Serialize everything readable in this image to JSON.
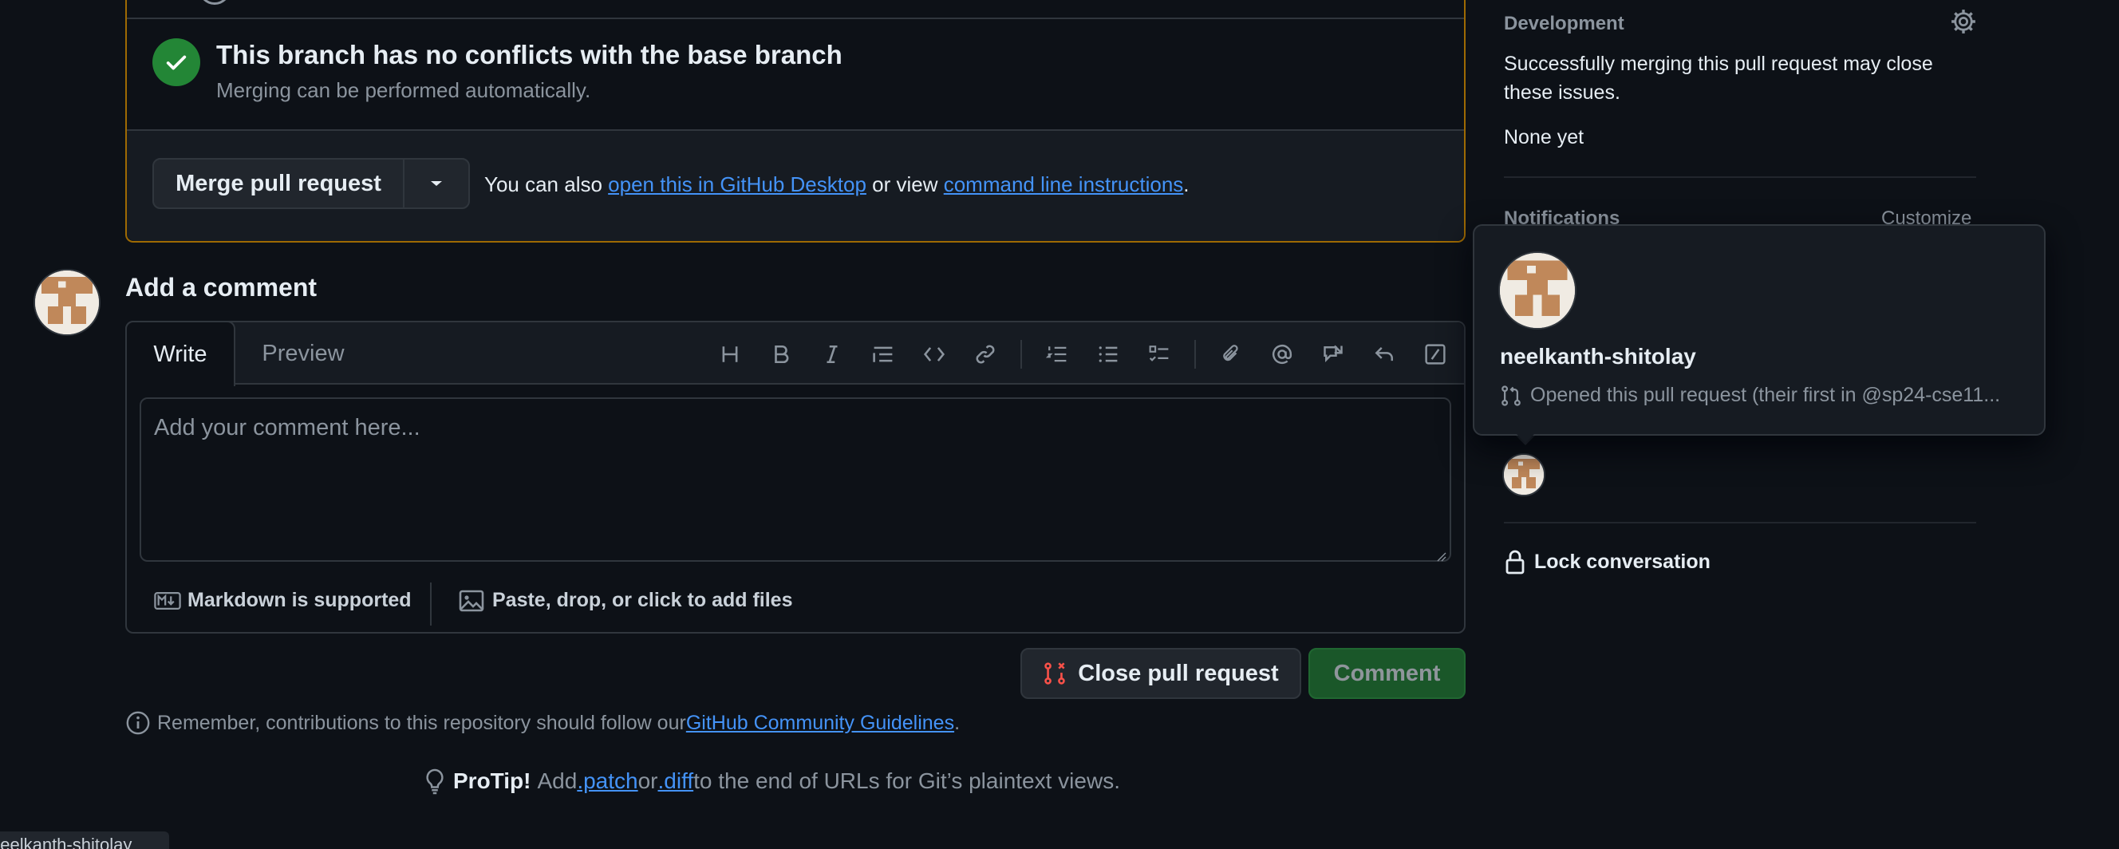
{
  "merge": {
    "status_title": "This branch has no conflicts with the base branch",
    "status_subtitle": "Merging can be performed automatically.",
    "merge_button_label": "Merge pull request",
    "hint_prefix": "You can also ",
    "hint_link_desktop": "open this in GitHub Desktop",
    "hint_middle": " or view ",
    "hint_link_cli": "command line instructions",
    "hint_suffix": "."
  },
  "comment": {
    "heading": "Add a comment",
    "tab_write": "Write",
    "tab_preview": "Preview",
    "placeholder": "Add your comment here...",
    "markdown_note": "Markdown is supported",
    "files_note": "Paste, drop, or click to add files",
    "close_button": "Close pull request",
    "comment_button": "Comment",
    "toolbar_icons": [
      "heading-icon",
      "bold-icon",
      "italic-icon",
      "quote-icon",
      "code-icon",
      "link-icon",
      "numbered-list-icon",
      "bullet-list-icon",
      "task-list-icon",
      "attach-icon",
      "mention-icon",
      "reference-icon",
      "reply-icon",
      "slash-commands-icon"
    ]
  },
  "guidelines": {
    "prefix": "Remember, contributions to this repository should follow our ",
    "link": "GitHub Community Guidelines",
    "suffix": "."
  },
  "protip": {
    "label": "ProTip!",
    "text_a": "Add ",
    "patch": ".patch",
    "text_b": " or ",
    "diff": ".diff",
    "text_c": " to the end of URLs for Git’s plaintext views."
  },
  "sidebar": {
    "development_heading": "Development",
    "development_text": "Successfully merging this pull request may close these issues.",
    "development_none": "None yet",
    "notifications_heading": "Notifications",
    "customize_label": "Customize",
    "lock_label": "Lock conversation"
  },
  "hovercard": {
    "username": "neelkanth-shitolay",
    "description": "Opened this pull request (their first in @sp24-cse11..."
  },
  "status_bar": {
    "text": "neelkanth-shitolay"
  },
  "colors": {
    "background": "#0d1117",
    "success": "#238636",
    "warning_border": "#9e6a03",
    "link": "#4493f8",
    "danger": "#f85149"
  }
}
